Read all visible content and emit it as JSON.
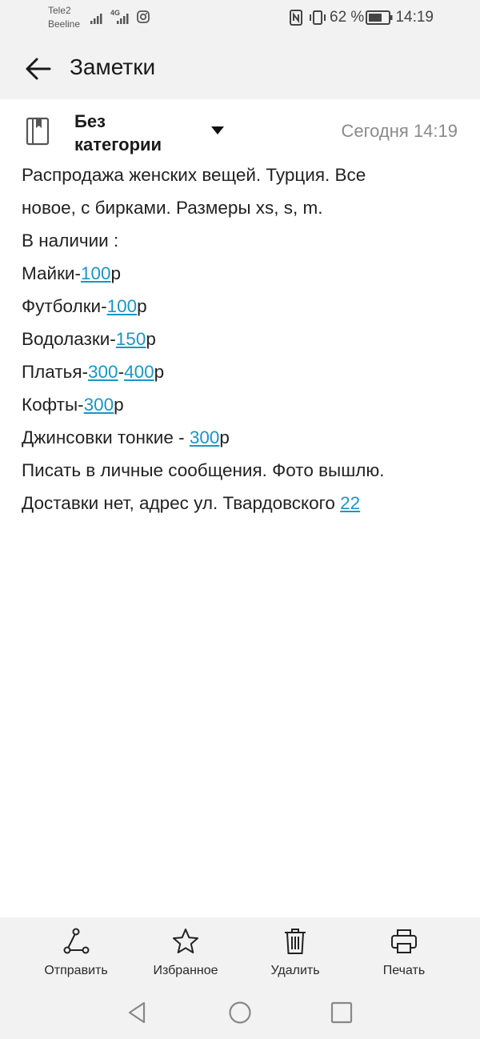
{
  "status_bar": {
    "carrier1": "Tele2",
    "carrier2": "Beeline",
    "network": "4G",
    "battery": "62 %",
    "time": "14:19"
  },
  "app_bar": {
    "title": "Заметки",
    "back_icon": "arrow-left-icon"
  },
  "note": {
    "category_line1": "Без",
    "category_line2": "категории",
    "date": "Сегодня 14:19",
    "lines": [
      {
        "segments": [
          {
            "text": "Распродажа женских вещей. Турция. Все"
          }
        ]
      },
      {
        "segments": [
          {
            "text": "новое, с бирками. Размеры xs, s, m."
          }
        ]
      },
      {
        "segments": [
          {
            "text": "В наличии :"
          }
        ]
      },
      {
        "segments": [
          {
            "text": "Майки-"
          },
          {
            "text": "100",
            "link": true
          },
          {
            "text": "р"
          }
        ]
      },
      {
        "segments": [
          {
            "text": "Футболки-"
          },
          {
            "text": "100",
            "link": true
          },
          {
            "text": "р"
          }
        ]
      },
      {
        "segments": [
          {
            "text": "Водолазки-"
          },
          {
            "text": "150",
            "link": true
          },
          {
            "text": "р"
          }
        ]
      },
      {
        "segments": [
          {
            "text": "Платья-"
          },
          {
            "text": "300",
            "link": true
          },
          {
            "text": "-"
          },
          {
            "text": "400",
            "link": true
          },
          {
            "text": "р"
          }
        ]
      },
      {
        "segments": [
          {
            "text": "Кофты-"
          },
          {
            "text": "300",
            "link": true
          },
          {
            "text": "р"
          }
        ]
      },
      {
        "segments": [
          {
            "text": "Джинсовки тонкие - "
          },
          {
            "text": "300",
            "link": true
          },
          {
            "text": "р"
          }
        ]
      },
      {
        "segments": [
          {
            "text": "Писать в личные сообщения. Фото вышлю."
          }
        ]
      },
      {
        "segments": [
          {
            "text": "Доставки нет, адрес ул. Твардовского "
          },
          {
            "text": "22",
            "link": true
          }
        ]
      }
    ]
  },
  "toolbar": {
    "send_label": "Отправить",
    "favorite_label": "Избранное",
    "delete_label": "Удалить",
    "print_label": "Печать"
  },
  "colors": {
    "link": "#1a96c4",
    "bar_bg": "#f2f2f2",
    "date": "#8a8a8a"
  }
}
